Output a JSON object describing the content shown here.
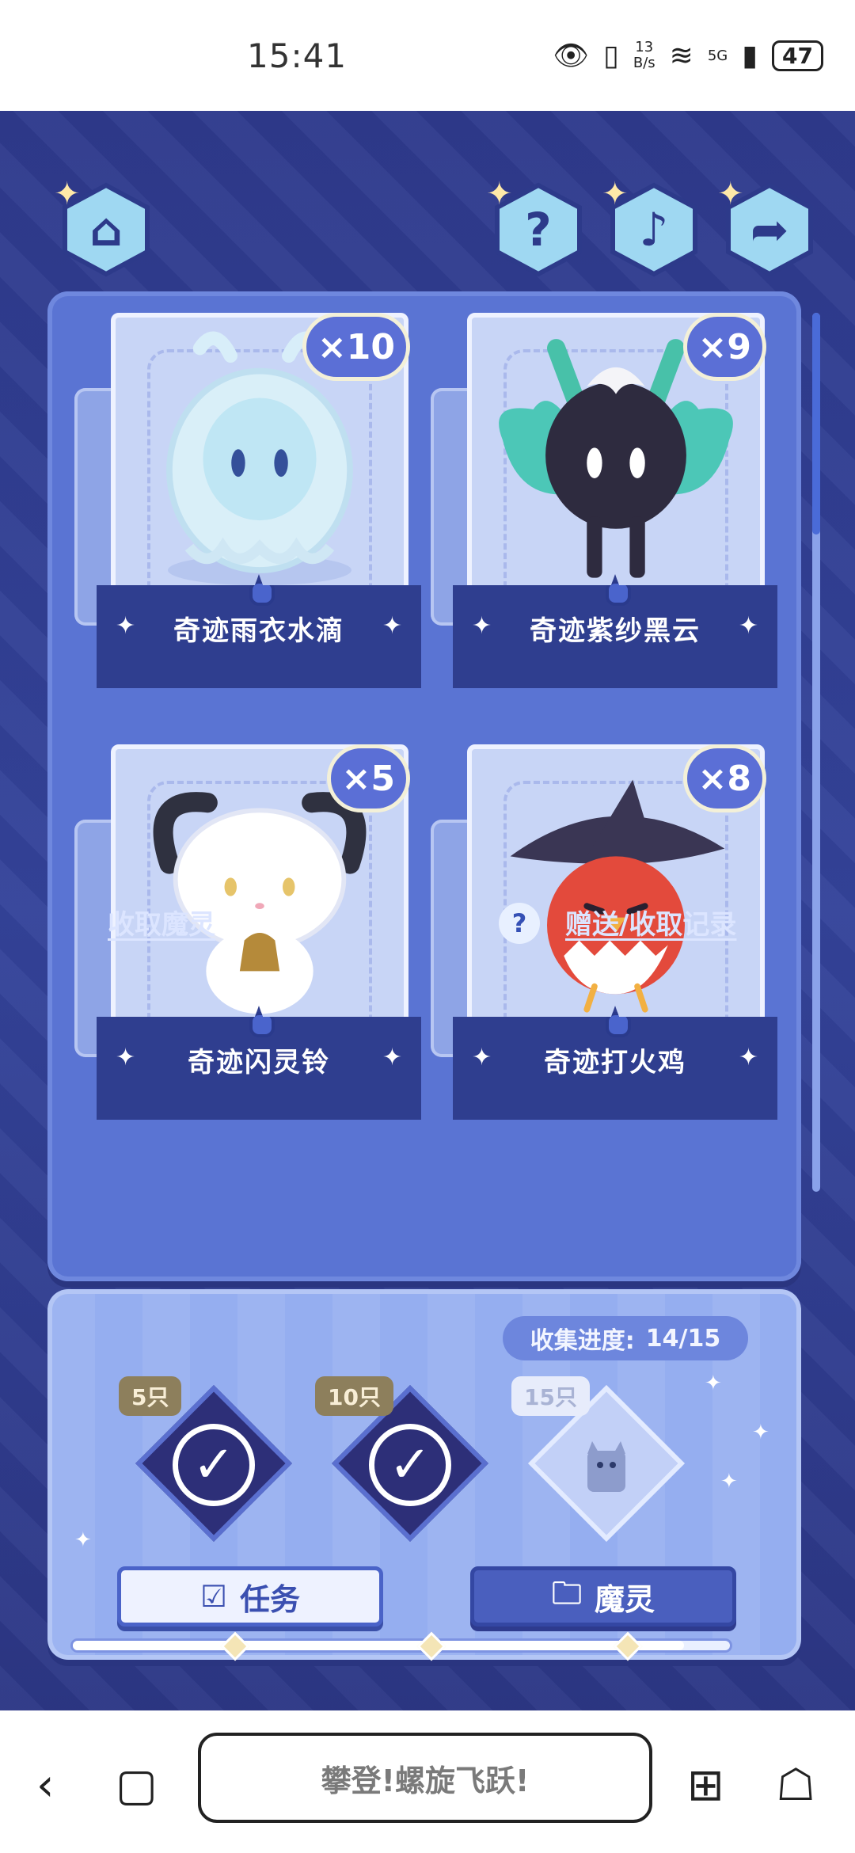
{
  "status_bar": {
    "time": "15:41",
    "net_speed_value": "13",
    "net_speed_unit": "B/s",
    "signal_label": "5G",
    "battery": "47"
  },
  "header_buttons": [
    {
      "name": "home-icon",
      "glyph": "⌂"
    },
    {
      "name": "help-icon",
      "glyph": "?"
    },
    {
      "name": "music-icon",
      "glyph": "♪"
    },
    {
      "name": "share-icon",
      "glyph": "➦"
    }
  ],
  "cards": [
    {
      "name": "奇迹雨衣水滴",
      "count": "×10",
      "accent": "#bfe6f4"
    },
    {
      "name": "奇迹紫纱黑云",
      "count": "×9",
      "accent": "#2e2b3f"
    },
    {
      "name": "奇迹闪灵铃",
      "count": "×5",
      "accent": "#ffffff"
    },
    {
      "name": "奇迹打火鸡",
      "count": "×8",
      "accent": "#e34a3c"
    }
  ],
  "links": {
    "collect": "收取魔灵",
    "help": "?",
    "records": "赠送/收取记录"
  },
  "progress": {
    "label": "收集进度:",
    "value": "14/15",
    "fraction": 0.93
  },
  "rewards": [
    {
      "tag": "5只",
      "done": true
    },
    {
      "tag": "10只",
      "done": true
    },
    {
      "tag": "15只",
      "done": false
    }
  ],
  "buttons": {
    "task": "任务",
    "spirit": "魔灵"
  },
  "nav": {
    "page_title": "攀登!螺旋飞跃!"
  },
  "colors": {
    "panel": "#5a74d3",
    "plate": "#2f3e8f",
    "badge": "#5b6fd6"
  }
}
